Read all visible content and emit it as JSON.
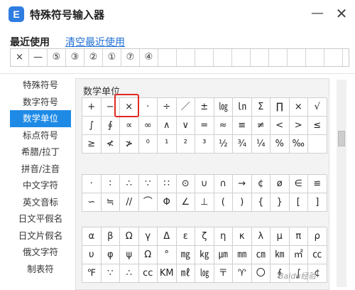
{
  "window": {
    "title": "特殊符号输入器",
    "icon_letter": "E",
    "minimize": "—",
    "close": "✕"
  },
  "recent": {
    "title": "最近使用",
    "clear_label": "清空最近使用",
    "items": [
      "×",
      "—",
      "⑤",
      "③",
      "②",
      "①",
      "⑦",
      "④",
      "",
      "",
      "",
      "",
      "",
      "",
      "",
      "",
      "",
      ""
    ]
  },
  "sidebar": {
    "items": [
      {
        "label": "特殊符号"
      },
      {
        "label": "数字符号"
      },
      {
        "label": "数学单位",
        "active": true
      },
      {
        "label": "标点符号"
      },
      {
        "label": "希腊/拉丁"
      },
      {
        "label": "拼音/注音"
      },
      {
        "label": "中文字符"
      },
      {
        "label": "英文音标"
      },
      {
        "label": "日文平假名"
      },
      {
        "label": "日文片假名"
      },
      {
        "label": "俄文字符"
      },
      {
        "label": "制表符"
      }
    ]
  },
  "panel": {
    "title": "数学单位",
    "section1": [
      "+",
      "−",
      "×",
      "·",
      "÷",
      "／",
      "±",
      "㏒",
      "㏑",
      "Σ",
      "∏",
      "×",
      "√",
      "∫",
      "∮",
      "∝",
      "∞",
      "∧",
      "∨",
      "=",
      "≈",
      "≡",
      "≠",
      "<",
      ">",
      "≤",
      "≥",
      "≮",
      "≯",
      "⁰",
      "¹",
      "²",
      "³",
      "½",
      "¾",
      "¼",
      "%",
      "‰",
      ""
    ],
    "section2": [
      "·",
      "∶",
      "∴",
      "∵",
      "∷",
      "⊙",
      "∪",
      "∩",
      "→",
      "¢",
      "ø",
      "∈",
      "≌",
      "∽",
      "≒",
      "//",
      "⌒",
      "Φ",
      "∠",
      "⊥",
      "(",
      ")",
      "{",
      "}",
      "[",
      "]"
    ],
    "section3": [
      "α",
      "β",
      "Ω",
      "γ",
      "Δ",
      "ε",
      "ζ",
      "η",
      "κ",
      "λ",
      "μ",
      "π",
      "ρ",
      "υ",
      "φ",
      "ψ",
      "Ω",
      "°",
      "㎎",
      "㎏",
      "㎛",
      "㎜",
      "㎝",
      "㎞",
      "㎡",
      "㏄",
      "℉",
      "∵",
      "∴",
      "cc",
      "KM",
      "㎖",
      "㏒",
      "〒",
      "♈",
      "〇",
      "∮",
      "∫",
      "¢"
    ]
  },
  "watermark": "Baidu经验",
  "colors": {
    "accent": "#1e8ae6",
    "link": "#1f6fd6",
    "highlight": "#e22a22"
  }
}
